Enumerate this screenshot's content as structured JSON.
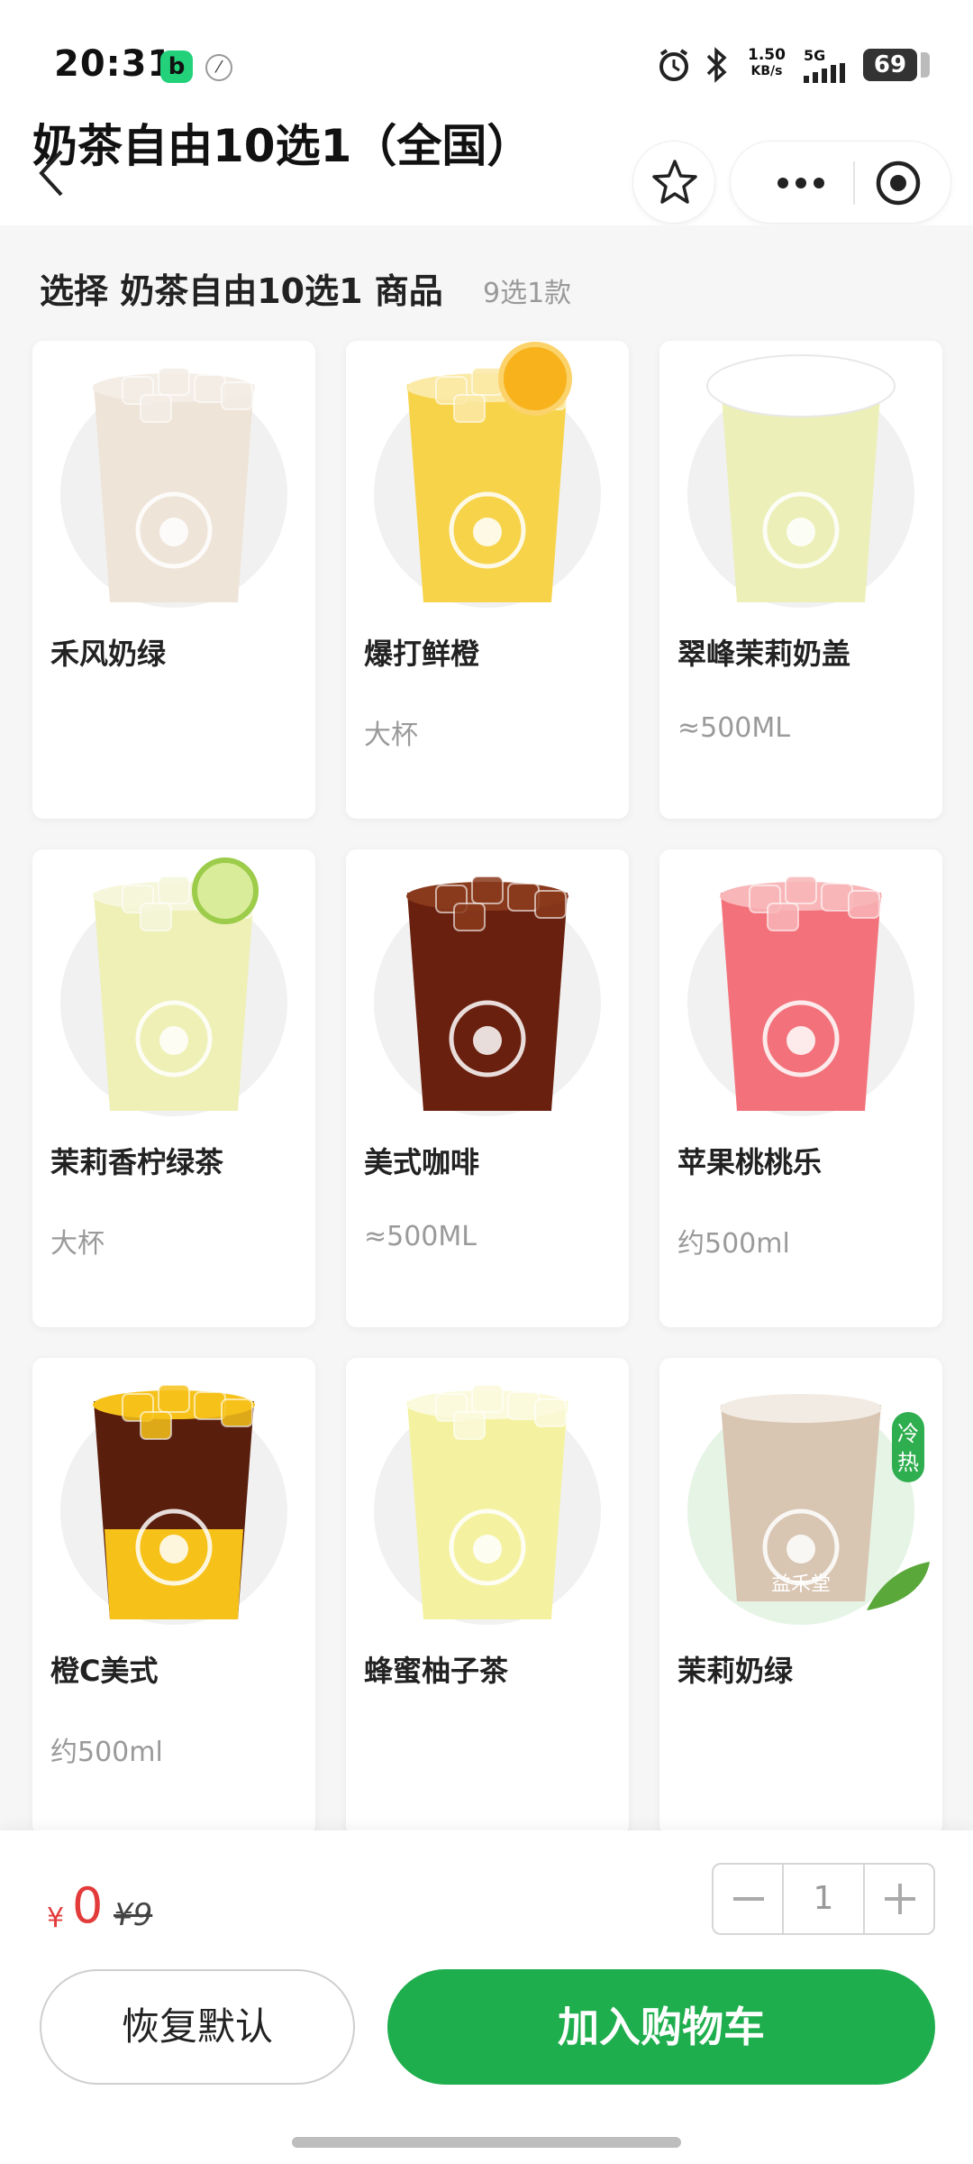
{
  "status_bar": {
    "time": "20:31",
    "app_badge": "b",
    "net_speed_value": "1.50",
    "net_speed_unit": "KB/s",
    "network": "5G",
    "battery": "69"
  },
  "header": {
    "title": "奶茶自由10选1（全国）"
  },
  "section": {
    "title": "选择 奶茶自由10选1 商品",
    "count": "9选1款"
  },
  "products": [
    {
      "name": "禾风奶绿",
      "spec": "",
      "drink": "milk-tea",
      "liquid": "#eee4d8",
      "top": "#f3ede6"
    },
    {
      "name": "爆打鲜橙",
      "spec": "大杯",
      "drink": "orange",
      "liquid": "#f7d34a",
      "top": "#fbe9a6"
    },
    {
      "name": "翠峰茉莉奶盖",
      "spec": "≈500ML",
      "drink": "cream-cap",
      "liquid": "#ecefb7",
      "top": "#ffffff"
    },
    {
      "name": "茉莉香柠绿茶",
      "spec": "大杯",
      "drink": "lemon",
      "liquid": "#eef0b6",
      "top": "#f5f6da"
    },
    {
      "name": "美式咖啡",
      "spec": "≈500ML",
      "drink": "coffee",
      "liquid": "#6a200e",
      "top": "#8a3a1c"
    },
    {
      "name": "苹果桃桃乐",
      "spec": "约500ml",
      "drink": "peach",
      "liquid": "#f2717a",
      "top": "#f8b6b8"
    },
    {
      "name": "橙C美式",
      "spec": "约500ml",
      "drink": "orange-coffee",
      "liquid": "#5a1e0d",
      "top": "#f6c21a"
    },
    {
      "name": "蜂蜜柚子茶",
      "spec": "",
      "drink": "honey",
      "liquid": "#f4f2a0",
      "top": "#fbfadc"
    },
    {
      "name": "茉莉奶绿",
      "spec": "",
      "drink": "hot-milk",
      "liquid": "#d8c5b2",
      "top": "#f1ebe3",
      "badge": "冷热",
      "brand": "益禾堂"
    }
  ],
  "bottom": {
    "currency": "¥",
    "price": "0",
    "original_price": "¥9",
    "quantity": "1",
    "reset_label": "恢复默认",
    "add_cart_label": "加入购物车"
  },
  "colors": {
    "accent": "#1fae4d",
    "price": "#e33a3a",
    "muted": "#9a9a9a"
  }
}
